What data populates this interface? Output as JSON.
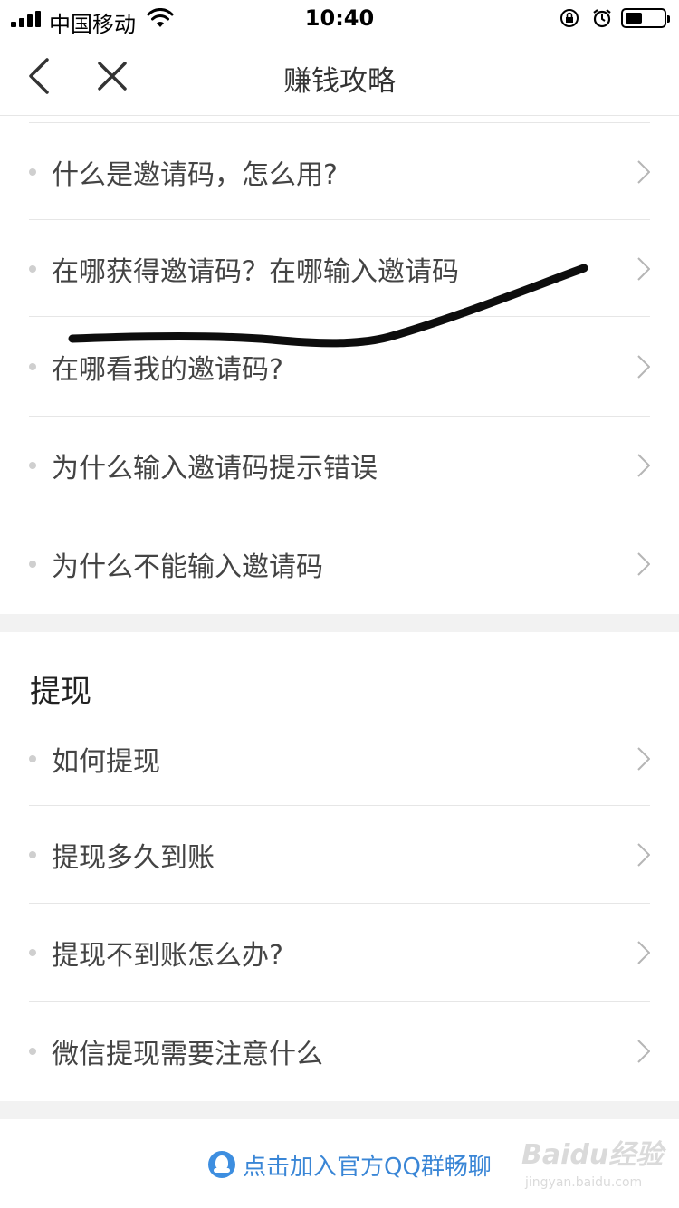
{
  "status_bar": {
    "carrier": "中国移动",
    "time": "10:40",
    "battery_level": 0.45
  },
  "nav": {
    "title": "赚钱攻略"
  },
  "invite_items": [
    {
      "label": "什么是邀请码，怎么用?"
    },
    {
      "label": "在哪获得邀请码？在哪输入邀请码"
    },
    {
      "label": "在哪看我的邀请码?"
    },
    {
      "label": "为什么输入邀请码提示错误"
    },
    {
      "label": "为什么不能输入邀请码"
    }
  ],
  "withdraw_section": {
    "title": "提现",
    "items": [
      {
        "label": "如何提现"
      },
      {
        "label": "提现多久到账"
      },
      {
        "label": "提现不到账怎么办?"
      },
      {
        "label": "微信提现需要注意什么"
      }
    ]
  },
  "bottom": {
    "qq_link": "点击加入官方QQ群畅聊"
  },
  "watermark": {
    "brand": "Baidu经验",
    "sub": "jingyan.baidu.com"
  },
  "colors": {
    "link_blue": "#3a86d6",
    "divider": "#e6e6e6",
    "band": "#f2f2f2"
  }
}
